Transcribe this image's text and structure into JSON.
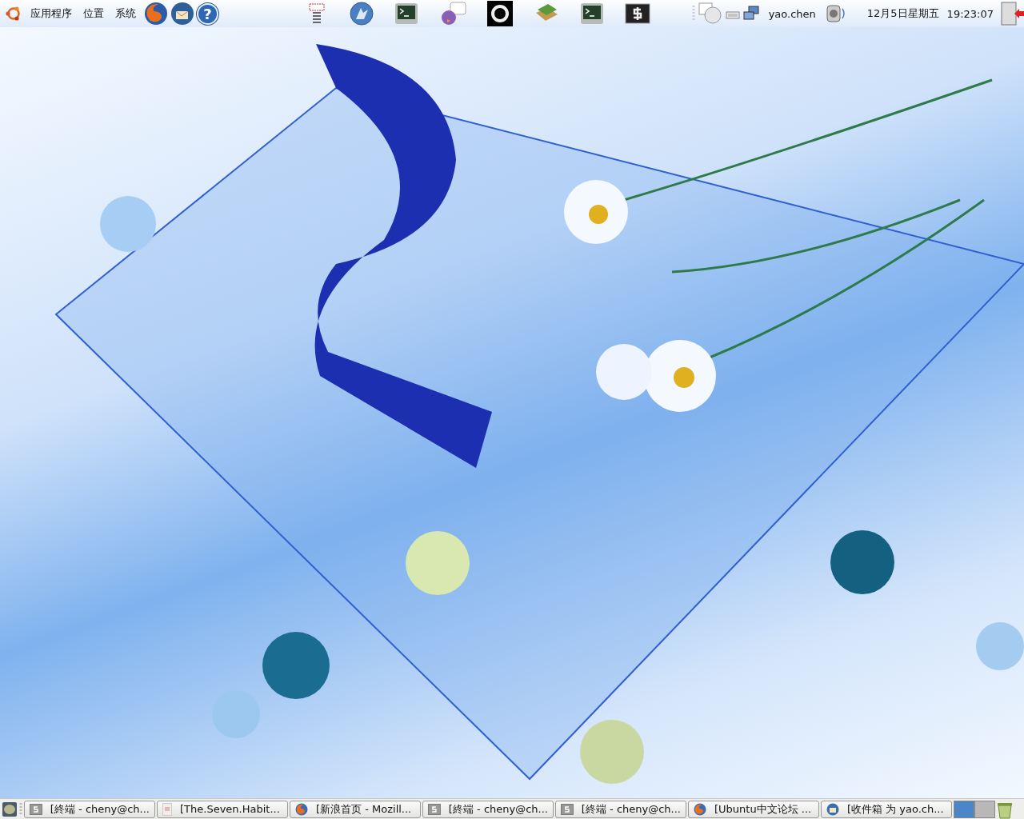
{
  "top_panel": {
    "menus": [
      {
        "label": "应用程序"
      },
      {
        "label": "位置"
      },
      {
        "label": "系统"
      }
    ],
    "help_glyph": "?",
    "user": "yao.chen",
    "date": "12月5日星期五",
    "time": "19:23:07"
  },
  "taskbar": {
    "windows": [
      {
        "kind": "terminal",
        "title": "[終端  - cheny@ch...",
        "selected": false
      },
      {
        "kind": "document",
        "title": "[The.Seven.Habit...",
        "selected": false
      },
      {
        "kind": "firefox",
        "title": "[新浪首页  - Mozill...",
        "selected": false
      },
      {
        "kind": "terminal",
        "title": "[終端  - cheny@ch...",
        "selected": false
      },
      {
        "kind": "terminal",
        "title": "[終端  - cheny@ch...",
        "selected": false
      },
      {
        "kind": "firefox",
        "title": "[Ubuntu中文论坛  ...",
        "selected": false
      },
      {
        "kind": "mail",
        "title": "[收件箱  为  yao.ch...",
        "selected": false
      }
    ],
    "workspaces": [
      {
        "selected": true
      },
      {
        "selected": false
      }
    ]
  }
}
